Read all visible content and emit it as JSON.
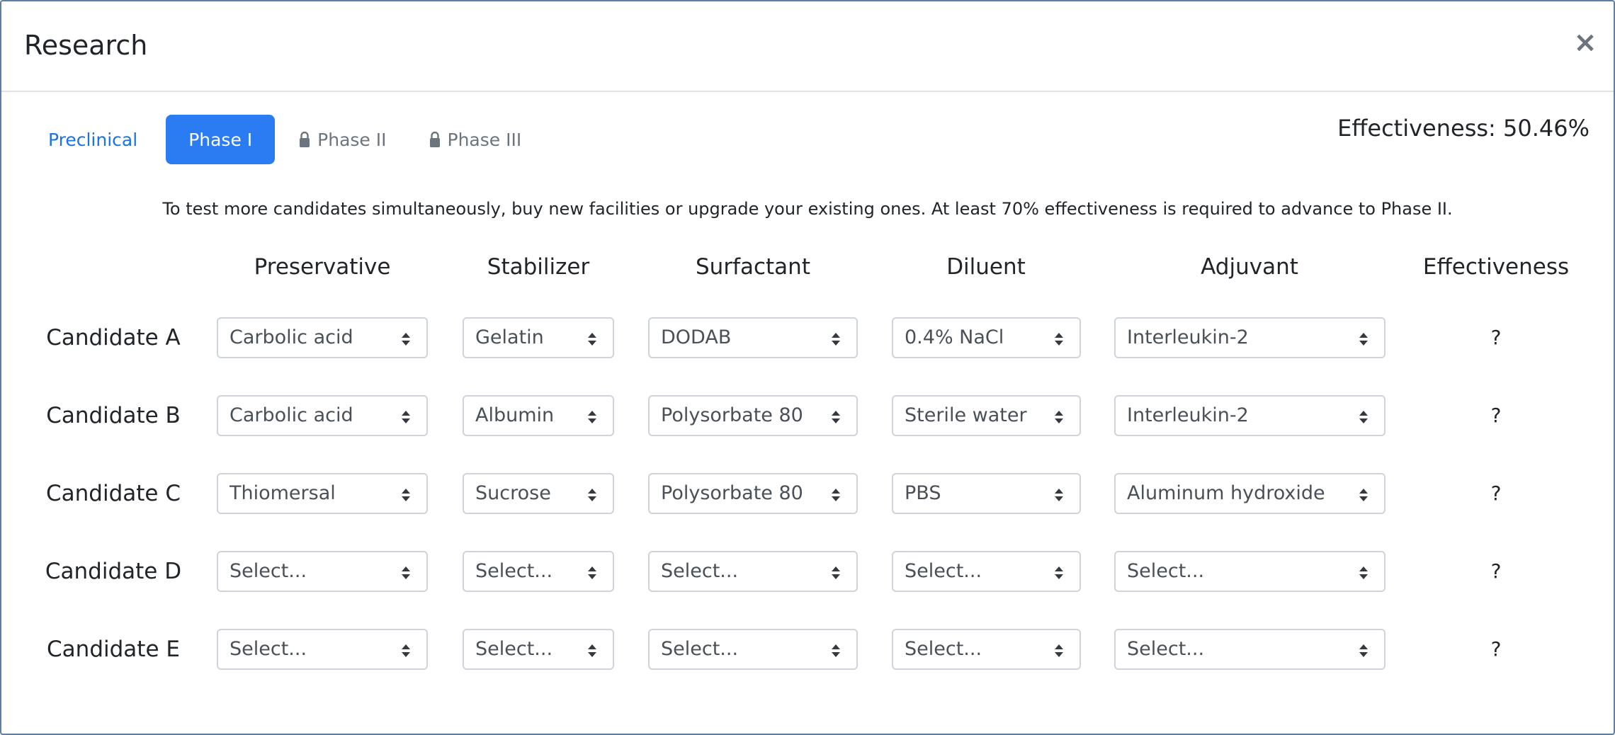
{
  "modal": {
    "title": "Research",
    "close_label": "×"
  },
  "tabs": [
    {
      "label": "Preclinical",
      "state": "link"
    },
    {
      "label": "Phase I",
      "state": "active"
    },
    {
      "label": "Phase II",
      "state": "locked"
    },
    {
      "label": "Phase III",
      "state": "locked"
    }
  ],
  "effectiveness_text": "Effectiveness: 50.46%",
  "notice": "To test more candidates simultaneously, buy new facilities or upgrade your existing ones. At least 70% effectiveness is required to advance to Phase II.",
  "columns": [
    "Preservative",
    "Stabilizer",
    "Surfactant",
    "Diluent",
    "Adjuvant",
    "Effectiveness"
  ],
  "candidates": [
    {
      "label": "Candidate A",
      "values": [
        "Carbolic acid",
        "Gelatin",
        "DODAB",
        "0.4% NaCl",
        "Interleukin-2"
      ],
      "effectiveness": "?"
    },
    {
      "label": "Candidate B",
      "values": [
        "Carbolic acid",
        "Albumin",
        "Polysorbate 80",
        "Sterile water",
        "Interleukin-2"
      ],
      "effectiveness": "?"
    },
    {
      "label": "Candidate C",
      "values": [
        "Thiomersal",
        "Sucrose",
        "Polysorbate 80",
        "PBS",
        "Aluminum hydroxide"
      ],
      "effectiveness": "?"
    },
    {
      "label": "Candidate D",
      "values": [
        "Select...",
        "Select...",
        "Select...",
        "Select...",
        "Select..."
      ],
      "effectiveness": "?"
    },
    {
      "label": "Candidate E",
      "values": [
        "Select...",
        "Select...",
        "Select...",
        "Select...",
        "Select..."
      ],
      "effectiveness": "?"
    }
  ],
  "colors": {
    "accent": "#2b7bf2",
    "link": "#1a73e8",
    "muted": "#6c757d",
    "border": "#ced4da"
  },
  "icons": {
    "lock": "lock-icon",
    "select_arrows": "sort-arrows-icon",
    "close": "close-icon"
  }
}
